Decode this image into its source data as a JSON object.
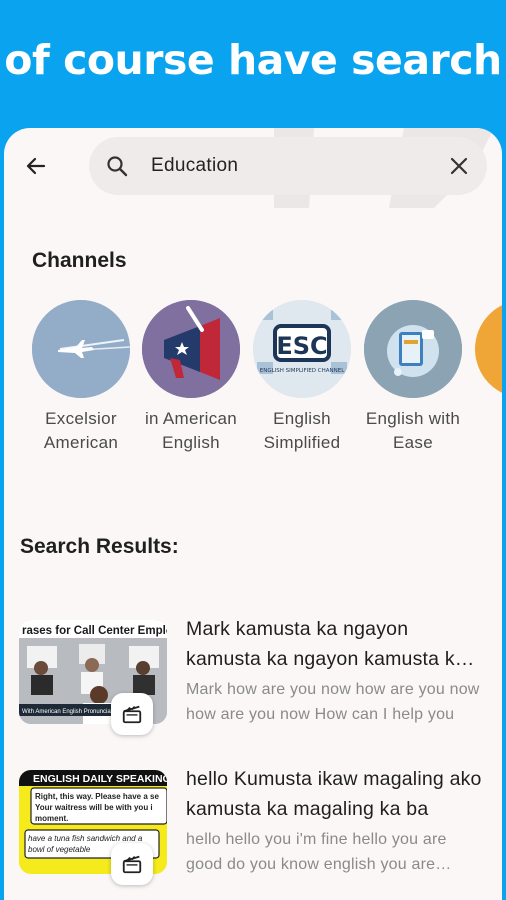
{
  "banner": {
    "text": "of course have search"
  },
  "search": {
    "value": "Education"
  },
  "channels_section": {
    "title": "Channels",
    "items": [
      {
        "name": "Excelsior American"
      },
      {
        "name": "in American English"
      },
      {
        "name": "English Simplified",
        "logo_text": "ESC",
        "logo_subtext": "ENGLISH SIMPLIFIED CHANNEL"
      },
      {
        "name": "English with Ease"
      }
    ]
  },
  "results_section": {
    "title": "Search Results:",
    "items": [
      {
        "title": "Mark kamusta ka ngayon kamusta ka ngayon kamusta ka ngayon",
        "description": "Mark how are you now how are you now how are you now How can I help you",
        "thumb_banner": "rases for Call Center Employe",
        "thumb_caption": "With American English Pronunciation"
      },
      {
        "title": "hello Kumusta ikaw magaling ako kamusta ka magaling ka ba",
        "description": "hello hello you i'm fine hello you are good do you know english you are amazing",
        "thumb_banner": "ENGLISH DAILY SPEAKING",
        "thumb_line1": "Right, this way. Please have a se",
        "thumb_line2": "Your waitress will be with you i",
        "thumb_line3": "moment.",
        "thumb_line4": "have a tuna fish sandwich and a",
        "thumb_line5": "bowl of vegetable"
      }
    ]
  },
  "colors": {
    "accent": "#0aa3f0",
    "background": "#fbf7f7",
    "search_bg": "#efebeb"
  }
}
